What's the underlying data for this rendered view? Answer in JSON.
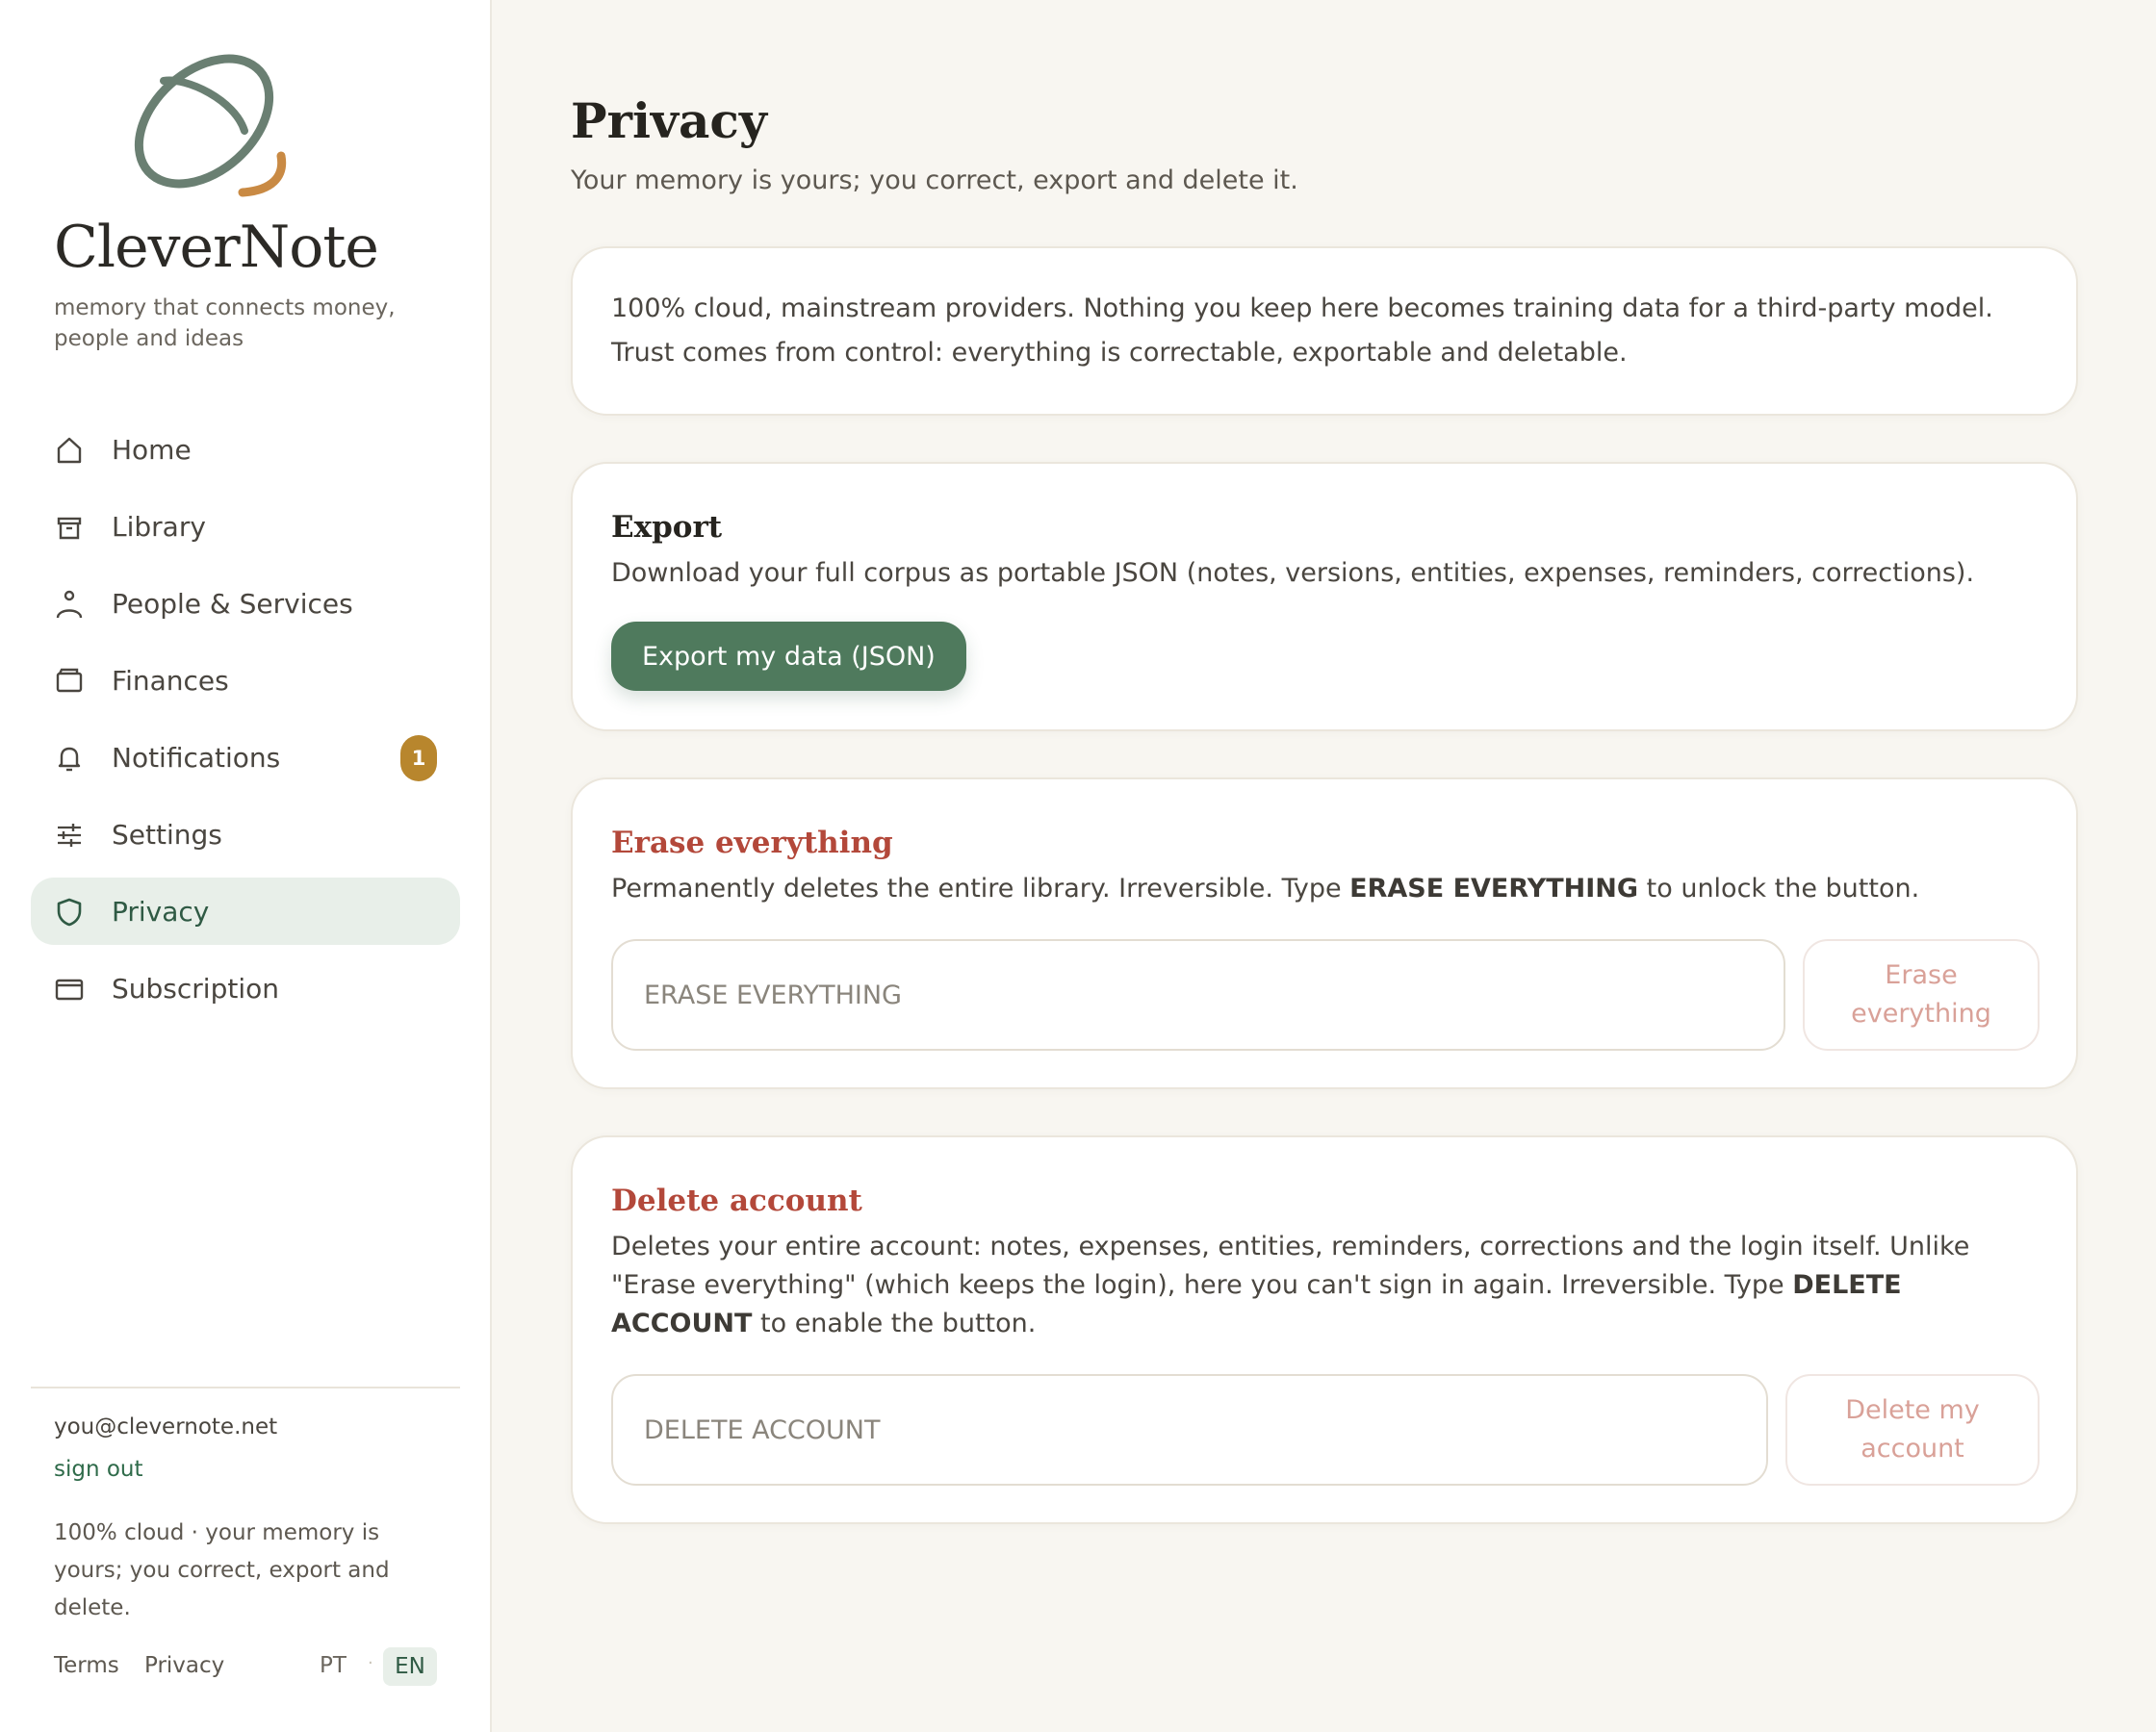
{
  "brand": {
    "name": "CleverNote",
    "tagline": "memory that connects money, people and ideas"
  },
  "nav": {
    "items": [
      {
        "label": "Home",
        "icon": "home-icon"
      },
      {
        "label": "Library",
        "icon": "archive-icon"
      },
      {
        "label": "People & Services",
        "icon": "person-icon"
      },
      {
        "label": "Finances",
        "icon": "wallet-icon"
      },
      {
        "label": "Notifications",
        "icon": "bell-icon",
        "badge": "1"
      },
      {
        "label": "Settings",
        "icon": "sliders-icon"
      },
      {
        "label": "Privacy",
        "icon": "shield-icon",
        "active": true
      },
      {
        "label": "Subscription",
        "icon": "card-icon"
      }
    ]
  },
  "account": {
    "email": "you@clevernote.net",
    "signout_label": "sign out"
  },
  "sidebar_note": "100% cloud · your memory is yours; you correct, export and delete.",
  "footer": {
    "terms_label": "Terms",
    "privacy_label": "Privacy",
    "lang_pt": "PT",
    "lang_sep": "·",
    "lang_en": "EN",
    "active_lang": "EN"
  },
  "page": {
    "title": "Privacy",
    "subtitle": "Your memory is yours; you correct, export and delete it."
  },
  "info_card": {
    "text": "100% cloud, mainstream providers. Nothing you keep here becomes training data for a third-party model. Trust comes from control: everything is correctable, exportable and deletable."
  },
  "export_card": {
    "title": "Export",
    "description": "Download your full corpus as portable JSON (notes, versions, entities, expenses, reminders, corrections).",
    "button_label": "Export my data (JSON)"
  },
  "erase_card": {
    "title": "Erase everything",
    "desc_before": "Permanently deletes the entire library. Irreversible. Type ",
    "desc_keyword": "ERASE EVERYTHING",
    "desc_after": " to unlock the button.",
    "input_placeholder": "ERASE EVERYTHING",
    "input_value": "",
    "button_label_line1": "Erase",
    "button_label_line2": "everything"
  },
  "delete_card": {
    "title": "Delete account",
    "desc_before": "Deletes your entire account: notes, expenses, entities, reminders, corrections and the login itself. Unlike \"Erase everything\" (which keeps the login), here you can't sign in again. Irreversible. Type ",
    "desc_keyword": "DELETE ACCOUNT",
    "desc_after": " to enable the button.",
    "input_placeholder": "DELETE ACCOUNT",
    "input_value": "",
    "button_label_line1": "Delete my",
    "button_label_line2": "account"
  },
  "colors": {
    "brand_green": "#4f7a5d",
    "danger_red": "#b3483a",
    "badge_amber": "#b8862d",
    "active_nav_bg": "#e8efe9",
    "page_bg": "#f8f6f1"
  }
}
